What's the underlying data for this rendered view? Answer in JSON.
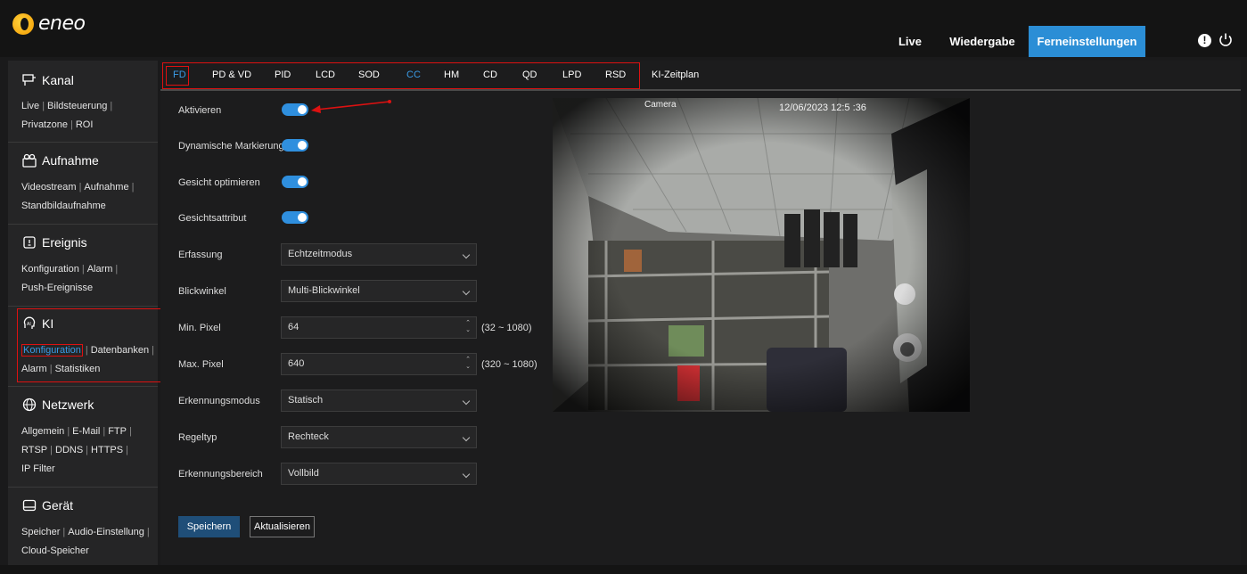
{
  "app": {
    "logo_text": "eneo"
  },
  "topnav": {
    "live": "Live",
    "playback": "Wiedergabe",
    "remote": "Ferneinstellungen"
  },
  "colors": {
    "accent": "#2b8ed6",
    "highlight": "#dd1111",
    "toggle_on": "#2f8fde"
  },
  "sidebar": {
    "kanal": {
      "title": "Kanal",
      "links": [
        "Live",
        "Bildsteuerung",
        "Privatzone",
        "ROI"
      ]
    },
    "aufnahme": {
      "title": "Aufnahme",
      "links": [
        "Videostream",
        "Aufnahme",
        "Standbildaufnahme"
      ]
    },
    "ereignis": {
      "title": "Ereignis",
      "links": [
        "Konfiguration",
        "Alarm",
        "Push-Ereignisse"
      ]
    },
    "ki": {
      "title": "KI",
      "links": [
        "Konfiguration",
        "Datenbanken",
        "Alarm",
        "Statistiken"
      ]
    },
    "netzwerk": {
      "title": "Netzwerk",
      "links": [
        "Allgemein",
        "E-Mail",
        "FTP",
        "RTSP",
        "DDNS",
        "HTTPS",
        "IP Filter"
      ]
    },
    "geraet": {
      "title": "Gerät",
      "links": [
        "Speicher",
        "Audio-Einstellung",
        "Cloud-Speicher"
      ]
    }
  },
  "tabs": [
    "FD",
    "PD & VD",
    "PID",
    "LCD",
    "SOD",
    "CC",
    "HM",
    "CD",
    "QD",
    "LPD",
    "RSD",
    "KI-Zeitplan"
  ],
  "form": {
    "aktivieren": {
      "label": "Aktivieren",
      "on": true
    },
    "dyn_mark": {
      "label": "Dynamische Markierung",
      "on": true
    },
    "gesicht_opt": {
      "label": "Gesicht optimieren",
      "on": true
    },
    "gesicht_attr": {
      "label": "Gesichtsattribut",
      "on": true
    },
    "erfassung": {
      "label": "Erfassung",
      "value": "Echtzeitmodus"
    },
    "blickwinkel": {
      "label": "Blickwinkel",
      "value": "Multi-Blickwinkel"
    },
    "min_pixel": {
      "label": "Min. Pixel",
      "value": "64",
      "range": "(32 ~ 1080)"
    },
    "max_pixel": {
      "label": "Max. Pixel",
      "value": "640",
      "range": "(320 ~ 1080)"
    },
    "erkennungsmodus": {
      "label": "Erkennungsmodus",
      "value": "Statisch"
    },
    "regeltyp": {
      "label": "Regeltyp",
      "value": "Rechteck"
    },
    "erkennungsbereich": {
      "label": "Erkennungsbereich",
      "value": "Vollbild"
    }
  },
  "buttons": {
    "save": "Speichern",
    "refresh": "Aktualisieren"
  },
  "preview": {
    "camera_name": "Camera",
    "timestamp": "12/06/2023 12:5  :36"
  }
}
